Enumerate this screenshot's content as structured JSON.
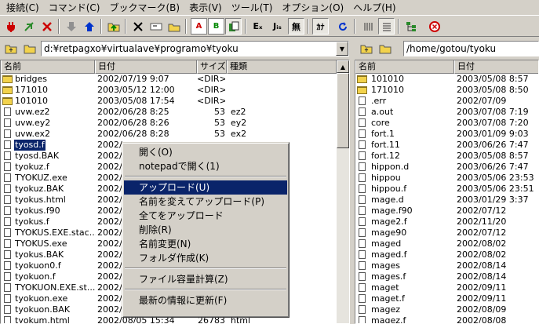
{
  "menu": [
    "接続(C)",
    "コマンド(C)",
    "ブックマーク(B)",
    "表示(V)",
    "ツール(T)",
    "オプション(O)",
    "ヘルプ(H)"
  ],
  "toolbar": {
    "b_label": "B",
    "a_label": "A",
    "e_label": "Eₓ",
    "j_label": "Jᵢₛ",
    "mu_label": "無",
    "ka_label": "ｶﾅ",
    "colors": {
      "red": "#cc0000",
      "blue": "#0033cc",
      "green": "#008800"
    }
  },
  "left_path": "d:¥retpagxo¥virtualave¥programo¥tyoku",
  "right_path": "/home/gotou/tyoku",
  "left_columns": {
    "name": "名前",
    "date": "日付",
    "size": "サイズ",
    "type": "種類"
  },
  "right_columns": {
    "name": "名前",
    "date": "日付"
  },
  "left_files": [
    {
      "icon": "folder",
      "name": "bridges",
      "date": "2002/07/19  9:07",
      "size": "<DIR>",
      "type": ""
    },
    {
      "icon": "folder",
      "name": "171010",
      "date": "2003/05/12 12:00",
      "size": "<DIR>",
      "type": ""
    },
    {
      "icon": "folder",
      "name": "101010",
      "date": "2003/05/08 17:54",
      "size": "<DIR>",
      "type": ""
    },
    {
      "icon": "file",
      "name": "uvw.ez2",
      "date": "2002/06/28  8:25",
      "size": "53",
      "type": "ez2"
    },
    {
      "icon": "file",
      "name": "uvw.ey2",
      "date": "2002/06/28  8:26",
      "size": "53",
      "type": "ey2"
    },
    {
      "icon": "file",
      "name": "uvw.ex2",
      "date": "2002/06/28  8:28",
      "size": "53",
      "type": "ex2"
    },
    {
      "icon": "file",
      "name": "tyosd.f",
      "date": "2002/",
      "size": "",
      "type": "",
      "selected": true
    },
    {
      "icon": "file",
      "name": "tyosd.BAK",
      "date": "2002/",
      "size": "",
      "type": ""
    },
    {
      "icon": "file",
      "name": "tyokuz.f",
      "date": "2002/",
      "size": "",
      "type": ""
    },
    {
      "icon": "file",
      "name": "TYOKUZ.exe",
      "date": "2002/",
      "size": "",
      "type": ""
    },
    {
      "icon": "file",
      "name": "tyokuz.BAK",
      "date": "2002/",
      "size": "",
      "type": ""
    },
    {
      "icon": "file",
      "name": "tyokus.html",
      "date": "2002/",
      "size": "",
      "type": ""
    },
    {
      "icon": "file",
      "name": "tyokus.f90",
      "date": "2002/",
      "size": "",
      "type": ""
    },
    {
      "icon": "file",
      "name": "tyokus.f",
      "date": "2002/",
      "size": "",
      "type": ""
    },
    {
      "icon": "file",
      "name": "TYOKUS.EXE.stac...",
      "date": "2002/",
      "size": "",
      "type": ""
    },
    {
      "icon": "file",
      "name": "TYOKUS.exe",
      "date": "2002/",
      "size": "",
      "type": ""
    },
    {
      "icon": "file",
      "name": "tyokus.BAK",
      "date": "2002/",
      "size": "",
      "type": ""
    },
    {
      "icon": "file",
      "name": "tyokuon0.f",
      "date": "2002/",
      "size": "",
      "type": ""
    },
    {
      "icon": "file",
      "name": "tyokuon.f",
      "date": "2002/",
      "size": "",
      "type": ""
    },
    {
      "icon": "file",
      "name": "TYOKUON.EXE.st...",
      "date": "2002/",
      "size": "",
      "type": ""
    },
    {
      "icon": "file",
      "name": "tyokuon.exe",
      "date": "2002/",
      "size": "",
      "type": ""
    },
    {
      "icon": "file",
      "name": "tyokuon.BAK",
      "date": "2002/",
      "size": "",
      "type": ""
    },
    {
      "icon": "file",
      "name": "tyokum.html",
      "date": "2002/08/05 15:34",
      "size": "26783",
      "type": "html"
    }
  ],
  "right_files": [
    {
      "icon": "folder",
      "name": "101010",
      "date": "2003/05/08  8:57"
    },
    {
      "icon": "folder",
      "name": "171010",
      "date": "2003/05/08  8:50"
    },
    {
      "icon": "file",
      "name": ".err",
      "date": "2002/07/09"
    },
    {
      "icon": "file",
      "name": "a.out",
      "date": "2003/07/08  7:19"
    },
    {
      "icon": "file",
      "name": "core",
      "date": "2003/07/08  7:20"
    },
    {
      "icon": "file",
      "name": "fort.1",
      "date": "2003/01/09  9:03"
    },
    {
      "icon": "file",
      "name": "fort.11",
      "date": "2003/06/26  7:47"
    },
    {
      "icon": "file",
      "name": "fort.12",
      "date": "2003/05/08  8:57"
    },
    {
      "icon": "file",
      "name": "hippon.d",
      "date": "2003/06/26  7:47"
    },
    {
      "icon": "file",
      "name": "hippou",
      "date": "2003/05/06 23:53"
    },
    {
      "icon": "file",
      "name": "hippou.f",
      "date": "2003/05/06 23:51"
    },
    {
      "icon": "file",
      "name": "mage.d",
      "date": "2003/01/29  3:37"
    },
    {
      "icon": "file",
      "name": "mage.f90",
      "date": "2002/07/12"
    },
    {
      "icon": "file",
      "name": "mage2.f",
      "date": "2002/11/20"
    },
    {
      "icon": "file",
      "name": "mage90",
      "date": "2002/07/12"
    },
    {
      "icon": "file",
      "name": "maged",
      "date": "2002/08/02"
    },
    {
      "icon": "file",
      "name": "maged.f",
      "date": "2002/08/02"
    },
    {
      "icon": "file",
      "name": "mages",
      "date": "2002/08/14"
    },
    {
      "icon": "file",
      "name": "mages.f",
      "date": "2002/08/14"
    },
    {
      "icon": "file",
      "name": "maget",
      "date": "2002/09/11"
    },
    {
      "icon": "file",
      "name": "maget.f",
      "date": "2002/09/11"
    },
    {
      "icon": "file",
      "name": "magez",
      "date": "2002/08/09"
    },
    {
      "icon": "file",
      "name": "magez.f",
      "date": "2002/08/08"
    }
  ],
  "context_menu": {
    "items": [
      {
        "label": "開く(O)",
        "group": 0
      },
      {
        "label": "notepadで開く(1)",
        "group": 0
      },
      {
        "label": "アップロード(U)",
        "group": 1,
        "highlighted": true
      },
      {
        "label": "名前を変えてアップロード(P)",
        "group": 1
      },
      {
        "label": "全てをアップロード",
        "group": 1
      },
      {
        "label": "削除(R)",
        "group": 1
      },
      {
        "label": "名前変更(N)",
        "group": 1
      },
      {
        "label": "フォルダ作成(K)",
        "group": 1
      },
      {
        "label": "ファイル容量計算(Z)",
        "group": 2
      },
      {
        "label": "最新の情報に更新(F)",
        "group": 3
      }
    ]
  }
}
